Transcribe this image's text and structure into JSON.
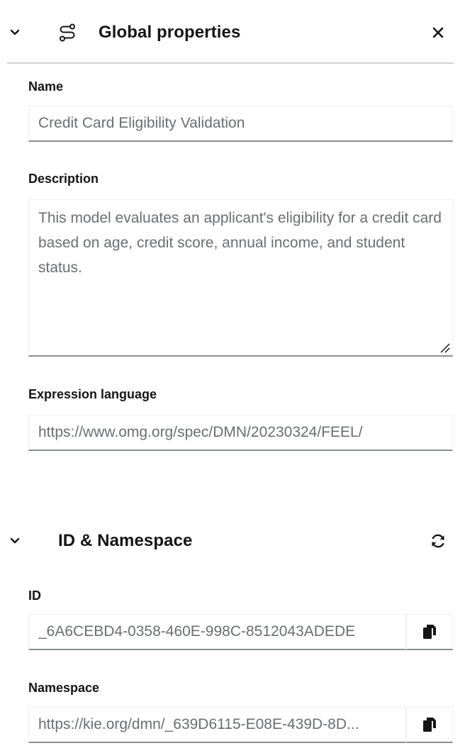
{
  "global_properties": {
    "title": "Global properties",
    "collapse_icon": "chevron-down-icon",
    "section_icon": "route-icon",
    "close_icon": "close-icon",
    "fields": {
      "name": {
        "label": "Name",
        "value": "Credit Card Eligibility Validation"
      },
      "description": {
        "label": "Description",
        "value": "This model evaluates an applicant's eligibility for a credit card based on age, credit score, annual income, and student status."
      },
      "expression_language": {
        "label": "Expression language",
        "value": "https://www.omg.org/spec/DMN/20230324/FEEL/"
      }
    }
  },
  "id_namespace": {
    "title": "ID & Namespace",
    "collapse_icon": "chevron-down-icon",
    "refresh_icon": "refresh-icon",
    "fields": {
      "id": {
        "label": "ID",
        "value": "_6A6CEBD4-0358-460E-998C-8512043ADEDE",
        "copy_icon": "copy-icon"
      },
      "namespace": {
        "label": "Namespace",
        "value": "https://kie.org/dmn/_639D6115-E08E-439D-8D...",
        "copy_icon": "copy-icon"
      }
    }
  },
  "colors": {
    "text": "#151515",
    "muted_text": "#6a6e73",
    "border": "#8a8d90",
    "divider": "#d2d2d2"
  }
}
